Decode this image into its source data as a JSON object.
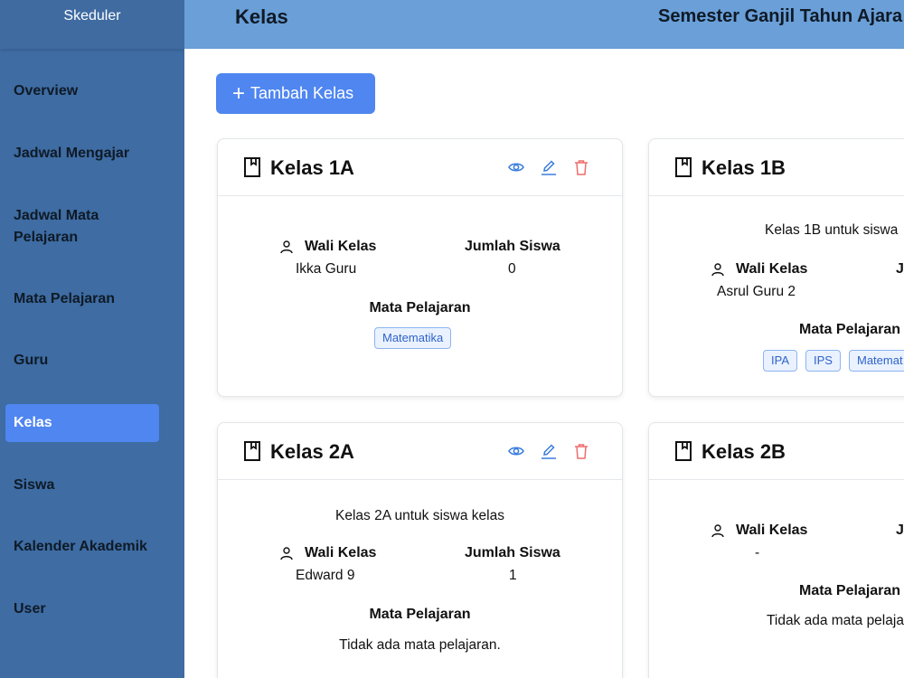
{
  "app": {
    "name": "Skeduler"
  },
  "header": {
    "title": "Kelas",
    "semester": "Semester Ganjil Tahun Ajara"
  },
  "sidebar": {
    "items": [
      {
        "label": "Overview"
      },
      {
        "label": "Jadwal Mengajar"
      },
      {
        "label": "Jadwal Mata Pelajaran"
      },
      {
        "label": "Mata Pelajaran"
      },
      {
        "label": "Guru"
      },
      {
        "label": "Kelas",
        "active": true
      },
      {
        "label": "Siswa"
      },
      {
        "label": "Kalender Akademik"
      },
      {
        "label": "User"
      }
    ]
  },
  "toolbar": {
    "add_label": "Tambah Kelas"
  },
  "labels": {
    "wali_kelas": "Wali Kelas",
    "jumlah_siswa": "Jumlah Siswa",
    "mata_pelajaran": "Mata Pelajaran"
  },
  "cards": [
    {
      "title": "Kelas 1A",
      "description": "",
      "wali_kelas": "Ikka Guru",
      "jumlah_siswa": "0",
      "subjects": [
        "Matematika"
      ],
      "empty_subjects": ""
    },
    {
      "title": "Kelas 1B",
      "description": "Kelas 1B untuk siswa",
      "wali_kelas": "Asrul Guru 2",
      "jumlah_label_visible": "J",
      "subjects": [
        "IPA",
        "IPS",
        "Matemat"
      ],
      "empty_subjects": ""
    },
    {
      "title": "Kelas 2A",
      "description": "Kelas 2A untuk siswa kelas",
      "wali_kelas": "Edward 9",
      "jumlah_siswa": "1",
      "subjects": [],
      "empty_subjects": "Tidak ada mata pelajaran."
    },
    {
      "title": "Kelas 2B",
      "description": "",
      "wali_kelas": "-",
      "jumlah_label_visible": "J",
      "subjects": [],
      "empty_subjects": "Tidak ada mata pelaja"
    }
  ],
  "colors": {
    "sidebar_bg": "#3e6ca3",
    "header_bg": "#6a9fd8",
    "accent": "#4f86f0",
    "view_icon": "#3b7ddd",
    "edit_icon": "#3b7ddd",
    "delete_icon": "#ef6b6b"
  },
  "icons": {
    "card": "book-icon",
    "wali": "user-icon",
    "view": "eye-icon",
    "edit": "pencil-icon",
    "delete": "trash-icon",
    "add": "plus-icon"
  }
}
